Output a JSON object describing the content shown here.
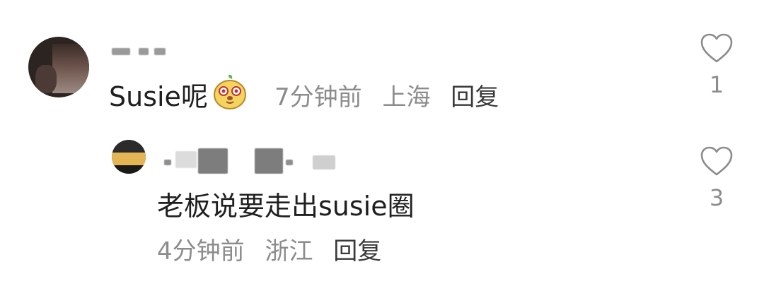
{
  "comment": {
    "text": "Susie呢",
    "emoji": "cute-dog-emoji",
    "time": "7分钟前",
    "location": "上海",
    "reply_label": "回复",
    "like_count": "1"
  },
  "reply": {
    "text": "老板说要走出susie圈",
    "time": "4分钟前",
    "location": "浙江",
    "reply_label": "回复",
    "like_count": "3"
  },
  "icons": {
    "like": "heart-outline-icon"
  },
  "colors": {
    "text_primary": "#1f1f1f",
    "text_secondary": "#8c8c8c",
    "emoji_yellow": "#f4d35e"
  }
}
